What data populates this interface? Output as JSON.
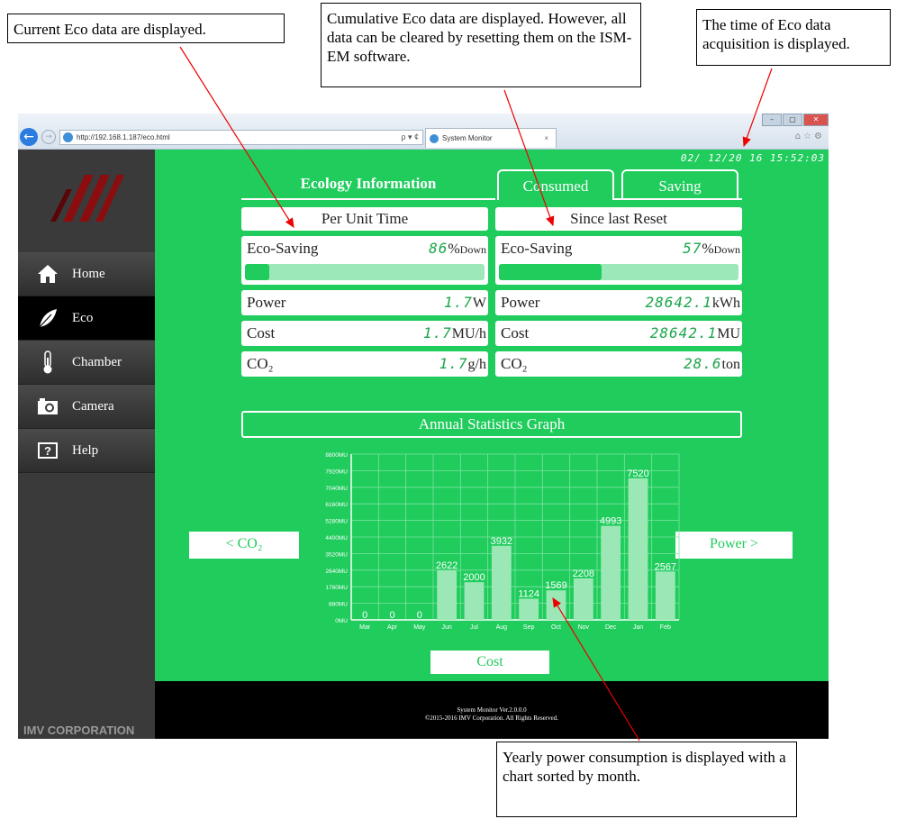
{
  "annotations": {
    "current": "Current Eco data are displayed.",
    "cumulative": "Cumulative Eco data are displayed. However, all data can be cleared by resetting them on the ISM-EM software.",
    "time": "The time of Eco data acquisition is displayed.",
    "yearly": "Yearly power consumption is displayed with a chart sorted by month."
  },
  "browser": {
    "url": "http://192.168.1.187/eco.html",
    "tab_title": "System Monitor",
    "tab_close": "×",
    "search_ctl": "ρ ▾ ¢"
  },
  "sidebar": {
    "items": [
      {
        "label": "Home",
        "icon": "home-icon"
      },
      {
        "label": "Eco",
        "icon": "leaf-icon"
      },
      {
        "label": "Chamber",
        "icon": "thermometer-icon"
      },
      {
        "label": "Camera",
        "icon": "camera-icon"
      },
      {
        "label": "Help",
        "icon": "help-icon"
      }
    ],
    "active": "Eco",
    "corporation": "IMV CORPORATION"
  },
  "header": {
    "datetime": "02/ 12/20 16  15:52:03",
    "title": "Ecology Information",
    "tabs": [
      "Consumed",
      "Saving"
    ]
  },
  "per_unit": {
    "heading": "Per Unit Time",
    "eco_label": "Eco-Saving",
    "eco_value": "86",
    "eco_unit": "%",
    "eco_suffix": "Down",
    "eco_fraction": 0.1,
    "power_label": "Power",
    "power_value": "1.7",
    "power_unit": "W",
    "cost_label": "Cost",
    "cost_value": "1.7",
    "cost_unit": "MU/h",
    "co2_label": "CO₂",
    "co2_value": "1.7",
    "co2_unit": "g/h"
  },
  "since_reset": {
    "heading": "Since last Reset",
    "eco_label": "Eco-Saving",
    "eco_value": "57",
    "eco_unit": "%",
    "eco_suffix": "Down",
    "eco_fraction": 0.43,
    "power_label": "Power",
    "power_value": "28642.1",
    "power_unit": "kWh",
    "cost_label": "Cost",
    "cost_value": "28642.1",
    "cost_unit": "MU",
    "co2_label": "CO₂",
    "co2_value": "28.6",
    "co2_unit": "ton"
  },
  "graph": {
    "title": "Annual Statistics Graph",
    "prev_button": "< CO₂",
    "next_button": "Power >",
    "mode_button": "Cost"
  },
  "footer": {
    "line1": "System Monitor Ver.2.0.0.0",
    "line2": "©2015-2016 IMV Corporation. All Rights Reserved."
  },
  "colors": {
    "accent": "#1fcc5c",
    "bar": "#9be8b6",
    "sidebar": "#3a3a3a"
  },
  "chart_data": {
    "type": "bar",
    "categories": [
      "Mar",
      "Apr",
      "May",
      "Jun",
      "Jul",
      "Aug",
      "Sep",
      "Oct",
      "Nov",
      "Dec",
      "Jan",
      "Feb"
    ],
    "values": [
      0,
      0,
      0,
      2622,
      2000,
      3932,
      1124,
      1569,
      2208,
      4993,
      7520,
      2567
    ],
    "ylim": [
      0,
      8800
    ],
    "yticks": [
      "0MU",
      "880MU",
      "1760MU",
      "2640MU",
      "3520MU",
      "4400MU",
      "5280MU",
      "6160MU",
      "7040MU",
      "7920MU",
      "8800MU"
    ],
    "grid": true
  }
}
